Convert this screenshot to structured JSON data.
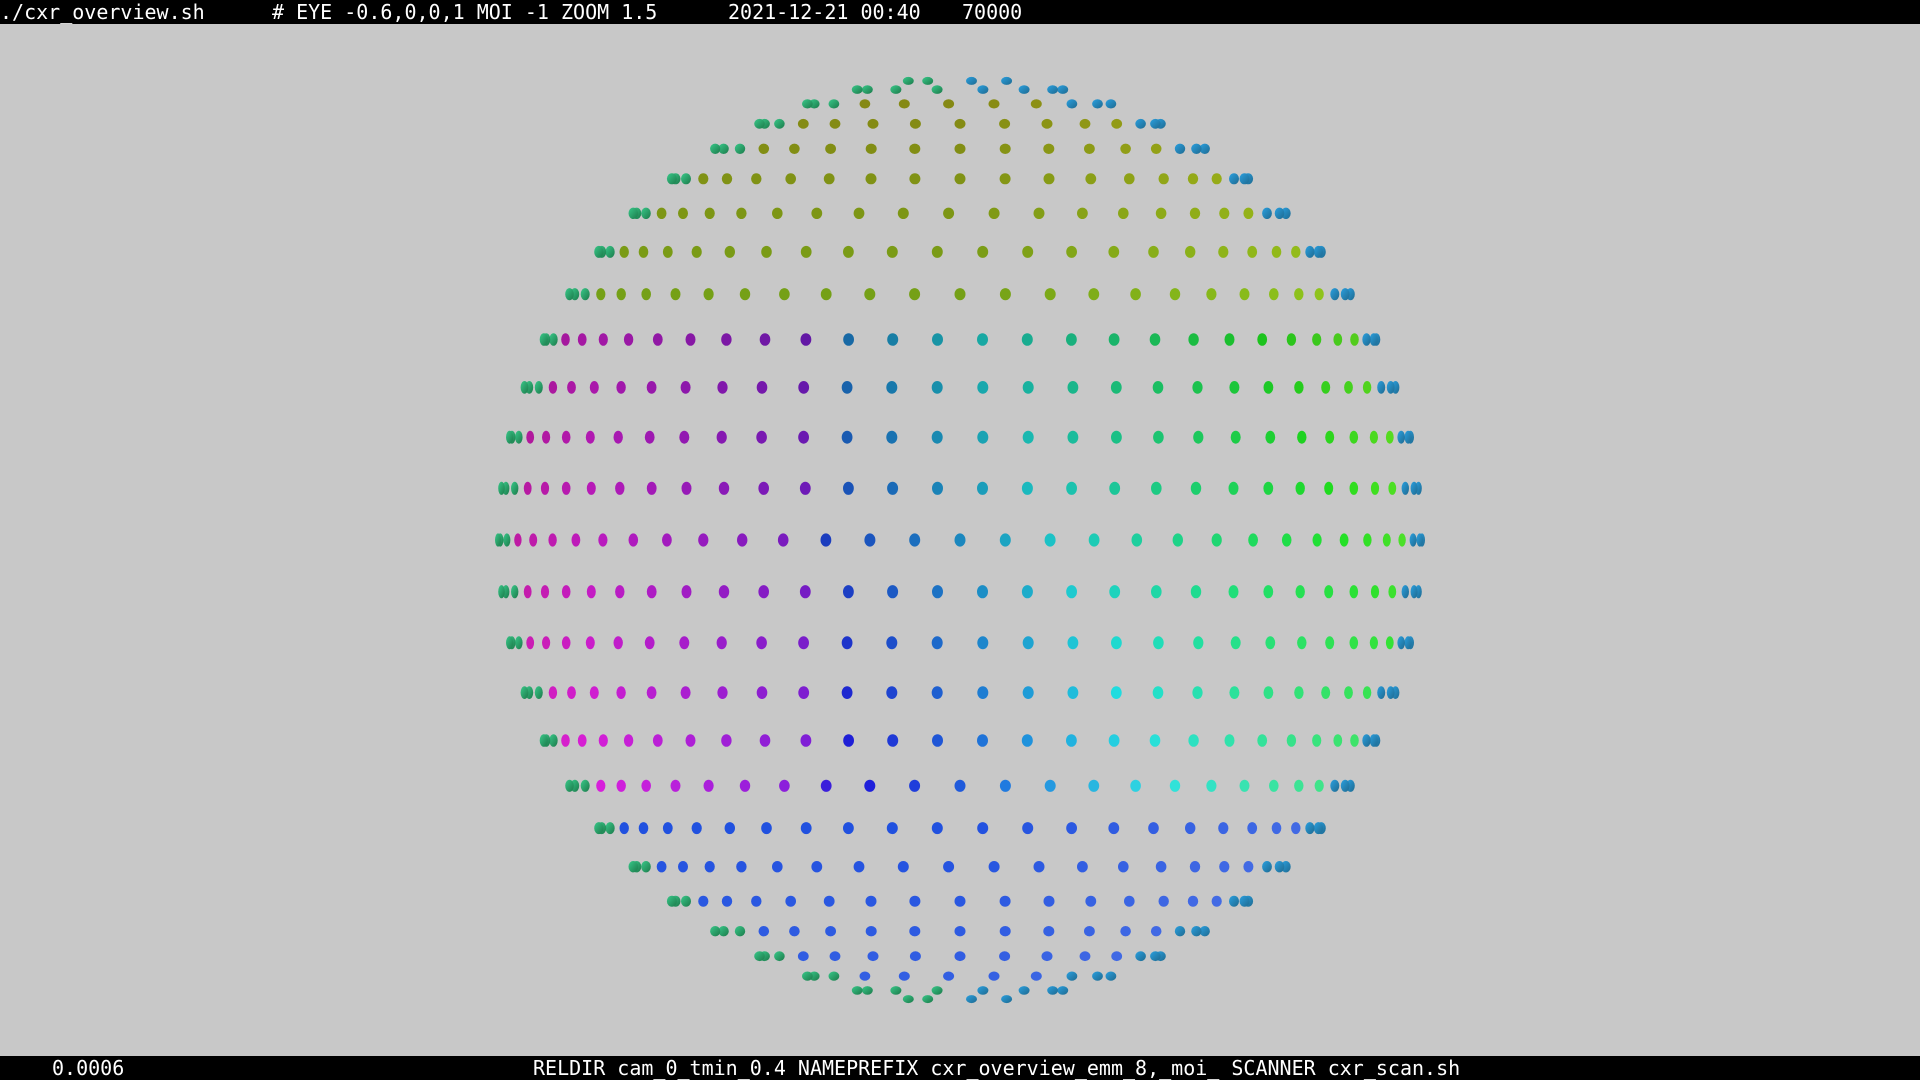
{
  "top_bar": {
    "script": "./cxr_overview.sh",
    "camera": "# EYE -0.6,0,0,1 MOI -1 ZOOM 1.5",
    "datetime": "2021-12-21 00:40",
    "count": "70000"
  },
  "bottom_bar": {
    "time_value": "0.0006",
    "config": "RELDIR cam_0_tmin_0.4 NAMEPREFIX cxr_overview_emm_8,_moi_ SCANNER cxr_scan.sh"
  },
  "colors": {
    "background": "#c8c8c8",
    "bars": "#000000",
    "bar_text": "#ffffff"
  }
}
